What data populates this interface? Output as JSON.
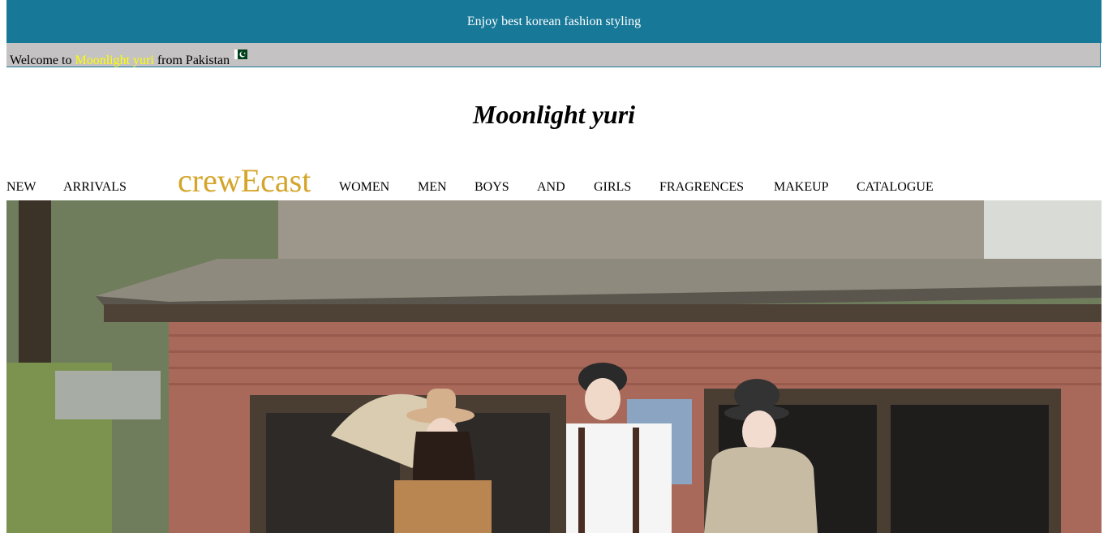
{
  "banner": {
    "text": "Enjoy best korean fashion styling"
  },
  "welcome": {
    "prefix": "Welcome to ",
    "brand": "Moonlight yuri",
    "suffix": " from Pakistan",
    "flag_icon": "pakistan-flag-icon"
  },
  "site": {
    "title": "Moonlight yuri"
  },
  "nav": {
    "items": [
      {
        "label": "NEW"
      },
      {
        "label": "ARRIVALS"
      },
      {
        "label": "WOMEN"
      },
      {
        "label": "MEN"
      },
      {
        "label": "BOYS"
      },
      {
        "label": "AND"
      },
      {
        "label": "GIRLS"
      },
      {
        "label": "FRAGRENCES"
      },
      {
        "label": "MAKEUP"
      },
      {
        "label": "CATALOGUE"
      }
    ],
    "logo": "crewEcast"
  },
  "hero": {
    "image": "korean-fashion-three-models-photo"
  },
  "colors": {
    "banner_bg": "#177898",
    "welcome_bg": "#c4c2c2",
    "brand_highlight": "#ffff00",
    "logo": "#d4a52a"
  }
}
